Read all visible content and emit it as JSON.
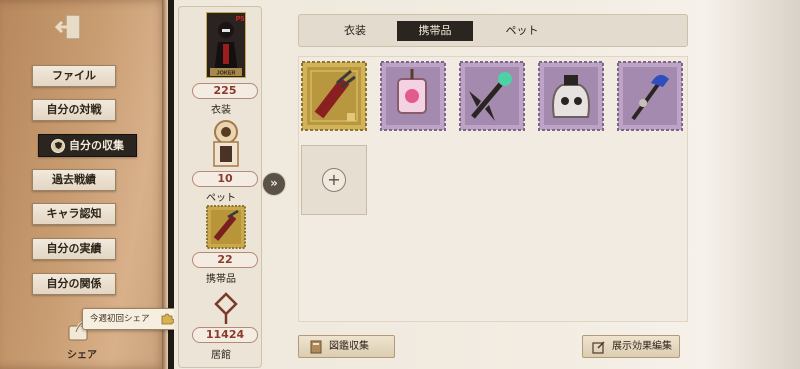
{
  "sidebar": {
    "items": [
      {
        "label": "ファイル"
      },
      {
        "label": "自分の対戦"
      },
      {
        "label": "自分の収集"
      },
      {
        "label": "過去戦績"
      },
      {
        "label": "キャラ認知"
      },
      {
        "label": "自分の実績"
      },
      {
        "label": "自分の関係"
      }
    ],
    "share_label": "シェア",
    "share_tooltip": "今週初回シェア"
  },
  "stats": {
    "costume": {
      "count": "225",
      "label": "衣装"
    },
    "pet": {
      "count": "10",
      "label": "ペット"
    },
    "accessory": {
      "count": "22",
      "label": "携帯品"
    },
    "residence": {
      "count": "11424",
      "label": "居館"
    },
    "card_text": "JOKER",
    "card_badge": "P5"
  },
  "tabs": [
    {
      "label": "衣装",
      "active": false
    },
    {
      "label": "携帯品",
      "active": true
    },
    {
      "label": "ペット",
      "active": false
    }
  ],
  "items": [
    {
      "icon": "red-glove-weapon-icon",
      "frame": "gold"
    },
    {
      "icon": "pink-lantern-icon",
      "frame": "purple"
    },
    {
      "icon": "dark-winged-staff-icon",
      "frame": "purple"
    },
    {
      "icon": "white-ghost-jar-icon",
      "frame": "purple"
    },
    {
      "icon": "blue-hat-cane-icon",
      "frame": "purple"
    }
  ],
  "buttons": {
    "catalog": "図鑑収集",
    "display_edit": "展示効果編集"
  },
  "colors": {
    "accent_dark": "#2b2520",
    "gold_frame": "#c9a94c",
    "purple_frame": "#b59bbf",
    "count_text": "#8a3b2a"
  }
}
